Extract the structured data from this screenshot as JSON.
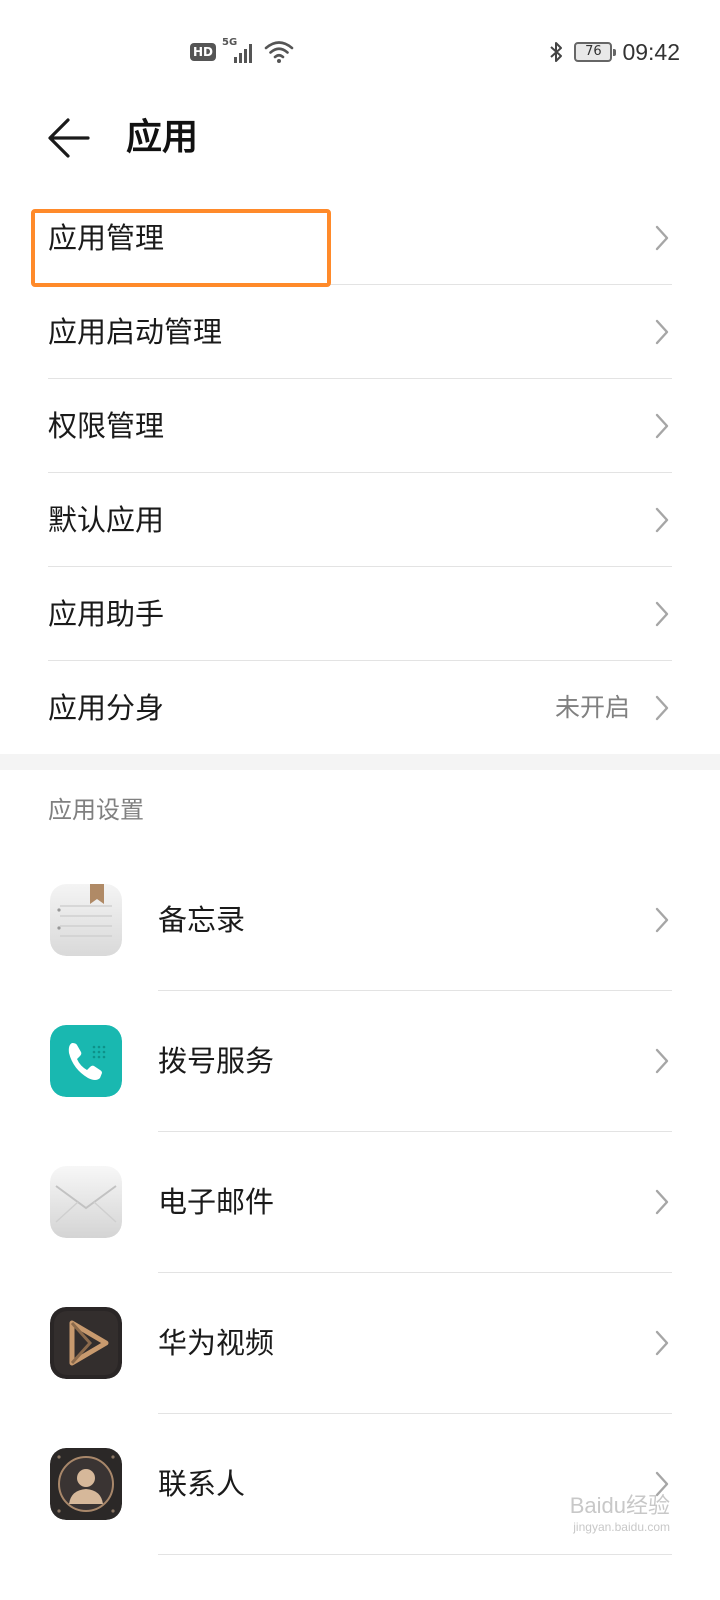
{
  "status_bar": {
    "hd_label": "HD",
    "network_label": "5G",
    "battery_level": "76",
    "time": "09:42",
    "icons": [
      "hd-icon",
      "signal-5g-icon",
      "wifi-icon",
      "bluetooth-icon",
      "battery-icon"
    ]
  },
  "header": {
    "title": "应用"
  },
  "menu": {
    "items": [
      {
        "label": "应用管理"
      },
      {
        "label": "应用启动管理"
      },
      {
        "label": "权限管理"
      },
      {
        "label": "默认应用"
      },
      {
        "label": "应用助手"
      },
      {
        "label": "应用分身",
        "value": "未开启"
      }
    ]
  },
  "app_settings": {
    "title": "应用设置",
    "apps": [
      {
        "label": "备忘录",
        "icon": "notepad-icon"
      },
      {
        "label": "拨号服务",
        "icon": "phone-icon"
      },
      {
        "label": "电子邮件",
        "icon": "email-icon"
      },
      {
        "label": "华为视频",
        "icon": "video-icon"
      },
      {
        "label": "联系人",
        "icon": "contacts-icon"
      }
    ]
  },
  "watermark": {
    "main": "Baidu经验",
    "sub": "jingyan.baidu.com"
  },
  "colors": {
    "highlight": "#ff8a2a",
    "phone_teal": "#19b8b0",
    "divider": "#e3e3e3"
  }
}
